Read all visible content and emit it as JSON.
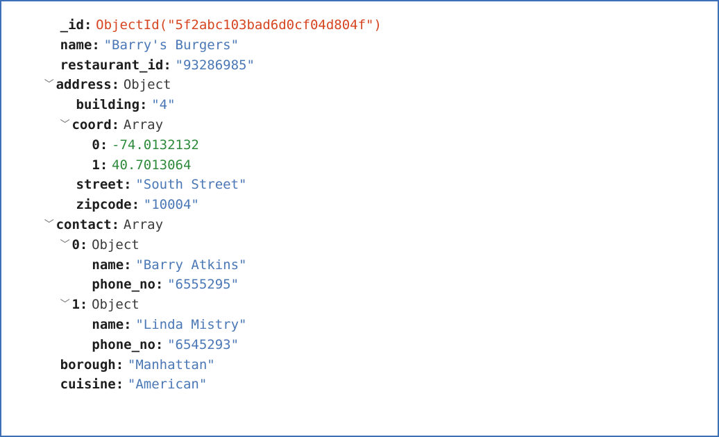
{
  "doc": {
    "id_key": "_id",
    "id_value": "ObjectId(\"5f2abc103bad6d0cf04d804f\")",
    "name_key": "name",
    "name_value": "\"Barry's Burgers\"",
    "restaurant_id_key": "restaurant_id",
    "restaurant_id_value": "\"93286985\"",
    "address_key": "address",
    "address_type": "Object",
    "address": {
      "building_key": "building",
      "building_value": "\"4\"",
      "coord_key": "coord",
      "coord_type": "Array",
      "coord": {
        "idx0_key": "0",
        "idx0_value": "-74.0132132",
        "idx1_key": "1",
        "idx1_value": "40.7013064"
      },
      "street_key": "street",
      "street_value": "\"South Street\"",
      "zipcode_key": "zipcode",
      "zipcode_value": "\"10004\""
    },
    "contact_key": "contact",
    "contact_type": "Array",
    "contact": {
      "idx0_key": "0",
      "idx0_type": "Object",
      "idx0": {
        "name_key": "name",
        "name_value": "\"Barry Atkins\"",
        "phone_key": "phone_no",
        "phone_value": "\"6555295\""
      },
      "idx1_key": "1",
      "idx1_type": "Object",
      "idx1": {
        "name_key": "name",
        "name_value": "\"Linda Mistry\"",
        "phone_key": "phone_no",
        "phone_value": "\"6545293\""
      }
    },
    "borough_key": "borough",
    "borough_value": "\"Manhattan\"",
    "cuisine_key": "cuisine",
    "cuisine_value": "\"American\""
  }
}
